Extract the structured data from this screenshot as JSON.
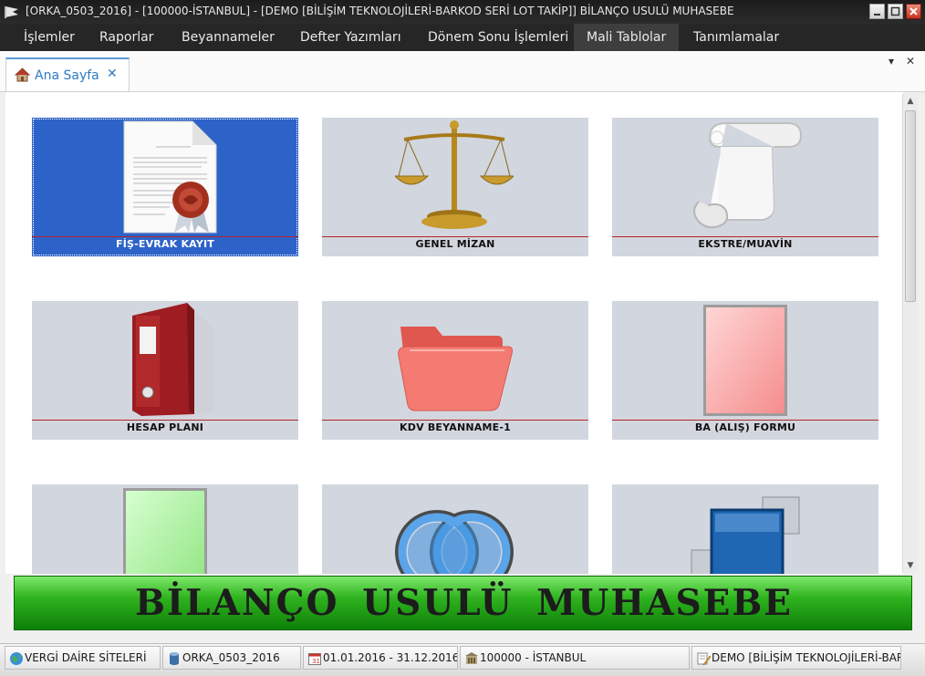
{
  "window": {
    "title": "[ORKA_0503_2016]   -   [100000-İSTANBUL]   -   [DEMO [BİLİŞİM TEKNOLOJİLERİ-BARKOD SERİ LOT TAKİP]]      BİLANÇO USULÜ MUHASEBE"
  },
  "menu": {
    "items": [
      "İşlemler",
      "Raporlar",
      "Beyannameler",
      "Defter Yazımları",
      "Dönem Sonu İşlemleri",
      "Mali Tablolar",
      "Tanımlamalar"
    ],
    "active_index": 5
  },
  "tab": {
    "label": "Ana Sayfa",
    "close": "✕"
  },
  "tab_controls": {
    "dropdown": "▾",
    "close": "✕"
  },
  "tiles": [
    {
      "label": "FİŞ-EVRAK KAYIT",
      "icon": "certificate-document-icon",
      "selected": true
    },
    {
      "label": "GENEL MİZAN",
      "icon": "balance-scale-icon"
    },
    {
      "label": "EKSTRE/MUAVİN",
      "icon": "paper-scroll-icon"
    },
    {
      "label": "HESAP PLANI",
      "icon": "binder-folder-icon"
    },
    {
      "label": "KDV BEYANNAME-1",
      "icon": "open-folder-icon"
    },
    {
      "label": "BA (ALIŞ) FORMU",
      "icon": "red-card-icon"
    },
    {
      "label": "",
      "icon": "green-card-icon"
    },
    {
      "label": "",
      "icon": "blue-rings-icon"
    },
    {
      "label": "",
      "icon": "blue-squares-icon"
    }
  ],
  "colors": {
    "selected_tile": "#2d63c8",
    "tile_bg": "#d2d6df",
    "tile_line": "#b5252b",
    "banner_green": "#2fb31f",
    "tab_accent": "#2e7bc4"
  },
  "banner": {
    "text": "BİLANÇO USULÜ MUHASEBE"
  },
  "statusbar": {
    "items": [
      {
        "text": "VERGİ DAİRE SİTELERİ",
        "icon": "globe-icon"
      },
      {
        "text": "ORKA_0503_2016",
        "icon": "database-icon"
      },
      {
        "text": "01.01.2016 - 31.12.2016",
        "icon": "calendar-icon"
      },
      {
        "text": "100000 - İSTANBUL",
        "icon": "building-icon"
      },
      {
        "text": "DEMO [BİLİŞİM TEKNOLOJİLERİ-BAR",
        "icon": "edit-document-icon"
      }
    ]
  }
}
